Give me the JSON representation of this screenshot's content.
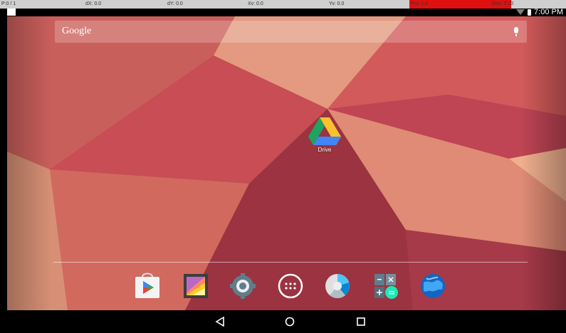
{
  "overlay": {
    "p": "P:0 / 1",
    "dx": "dX: 0.0",
    "dy": "dY: 0.0",
    "xv": "Xv: 0.0",
    "yv": "Yv: 0.0",
    "prs": "Prs: 1.0",
    "size": "Size: 0.20"
  },
  "status_bar": {
    "time": "7:00 PM",
    "icons": [
      "wifi-icon",
      "battery-icon"
    ]
  },
  "search": {
    "label": "Google",
    "icon": "mic-icon"
  },
  "home": {
    "shortcuts": [
      {
        "name": "Drive",
        "icon": "drive-icon"
      }
    ]
  },
  "dock": {
    "apps": [
      {
        "name": "Play Store",
        "icon": "play-store-icon"
      },
      {
        "name": "Gallery",
        "icon": "gallery-icon"
      },
      {
        "name": "Settings",
        "icon": "settings-icon"
      },
      {
        "name": "All apps",
        "icon": "app-drawer-icon"
      },
      {
        "name": "Camera",
        "icon": "camera-icon"
      },
      {
        "name": "Calculator",
        "icon": "calculator-icon"
      },
      {
        "name": "Browser",
        "icon": "browser-icon"
      }
    ]
  },
  "nav_bar": {
    "buttons": [
      "back-icon",
      "home-icon",
      "recents-icon"
    ]
  },
  "colors": {
    "overlay_bg": "#cfcfcf",
    "overlay_alert": "#e01010",
    "wallpaper_base": "#b64a50"
  }
}
